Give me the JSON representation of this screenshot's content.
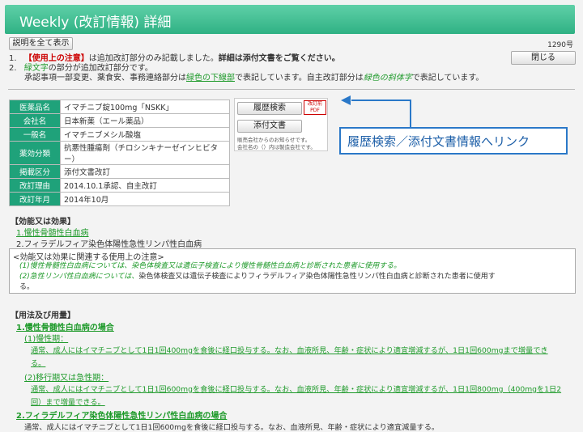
{
  "header": {
    "title": "Weekly (改訂情報) 詳細"
  },
  "toolbar": {
    "show_all": "説明を全て表示",
    "close": "閉じる",
    "count": "1290号"
  },
  "notes": {
    "n1_num": "1.",
    "n1_a": "【使用上の注意】",
    "n1_b": "は追加改訂部分のみ記載しました。",
    "n1_c": "詳細は添付文書をご覧ください。",
    "n2_num": "2.",
    "n2_a": "緑文字",
    "n2_b": "の部分が追加改訂部分です。",
    "n3_a": "承認事項一部変更、薬食安、事務連絡部分は",
    "n3_b": "緑色の下線部",
    "n3_c": "で表記しています。自主改訂部分は",
    "n3_d": "緑色の斜体字",
    "n3_e": "で表記しています。"
  },
  "info": [
    {
      "k": "医薬品名",
      "v": "イマチニブ錠100mg「NSKK」"
    },
    {
      "k": "会社名",
      "v": "日本新薬（エール薬品）"
    },
    {
      "k": "一般名",
      "v": "イマチニブメシル酸塩"
    },
    {
      "k": "薬効分類",
      "v": "抗悪性腫瘍剤（チロシンキナーゼインヒビター）"
    },
    {
      "k": "掲載区分",
      "v": "添付文書改訂"
    },
    {
      "k": "改訂理由",
      "v": "2014.10.1承認、自主改訂"
    },
    {
      "k": "改訂年月",
      "v": "2014年10月"
    }
  ],
  "side": {
    "history": "履歴検索",
    "attach": "添付文書",
    "pdf": "改訂前PDF",
    "note1": "販売会社からのお知らせです。",
    "note2": "会社名の（）内は製造会社です。"
  },
  "callout": {
    "text": "履歴検索／添付文書情報へリンク"
  },
  "effect": {
    "title": "【効能又は効果】",
    "i1": "1.慢性骨髄性白血病",
    "i2": "2.フィラデルフィア染色体陽性急性リンパ性白血病",
    "box_title": "<効能又は効果に関連する使用上の注意>",
    "b1": "(1)慢性骨髄性白血病については、染色体検査又は遺伝子検査により慢性骨髄性白血病と診断された患者に使用する。",
    "b2a": "(2)急性リンパ性白血病については、",
    "b2b": "染色体検査又は遺伝子検査によりフィラデルフィア染色体陽性急性リンパ性白血病と診断された患者に使用す",
    "b2c": "る。"
  },
  "dosage": {
    "title": "【用法及び用量】",
    "h1": "1.慢性骨髄性白血病の場合",
    "s1": "(1)慢性期：",
    "t1a": "通常、成人にはイマチニブとして1日1回400mgを食後に経口投与する。なお、血液所見、年齢・症状により適宜増減するが、1日1回600mgまで増量でき",
    "t1b": "る。",
    "s2": "(2)移行期又は急性期：",
    "t2a": "通常、成人にはイマチニブとして1日1回600mgを食後に経口投与する。なお、血液所見、年齢・症状により適宜増減するが、1日1回800mg（400mgを1日2",
    "t2b": "回）まで増量できる。",
    "h2": "2.フィラデルフィア染色体陽性急性リンパ性白血病の場合",
    "t3": "通常、成人にはイマチニブとして1日1回600mgを食後に経口投与する。なお、血液所見、年齢・症状により適宜減量する。"
  }
}
